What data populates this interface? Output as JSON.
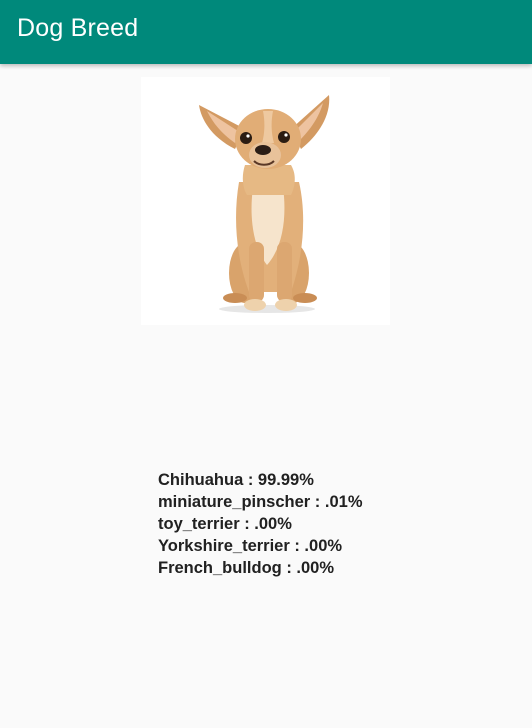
{
  "app_bar": {
    "title": "Dog Breed",
    "color": "#00897b"
  },
  "image": {
    "subject": "dog-photo",
    "background": "#ffffff"
  },
  "predictions": [
    {
      "label": "Chihuahua : 99.99%"
    },
    {
      "label": "miniature_pinscher : .01%"
    },
    {
      "label": "toy_terrier : .00%"
    },
    {
      "label": "Yorkshire_terrier : .00%"
    },
    {
      "label": "French_bulldog : .00%"
    }
  ]
}
